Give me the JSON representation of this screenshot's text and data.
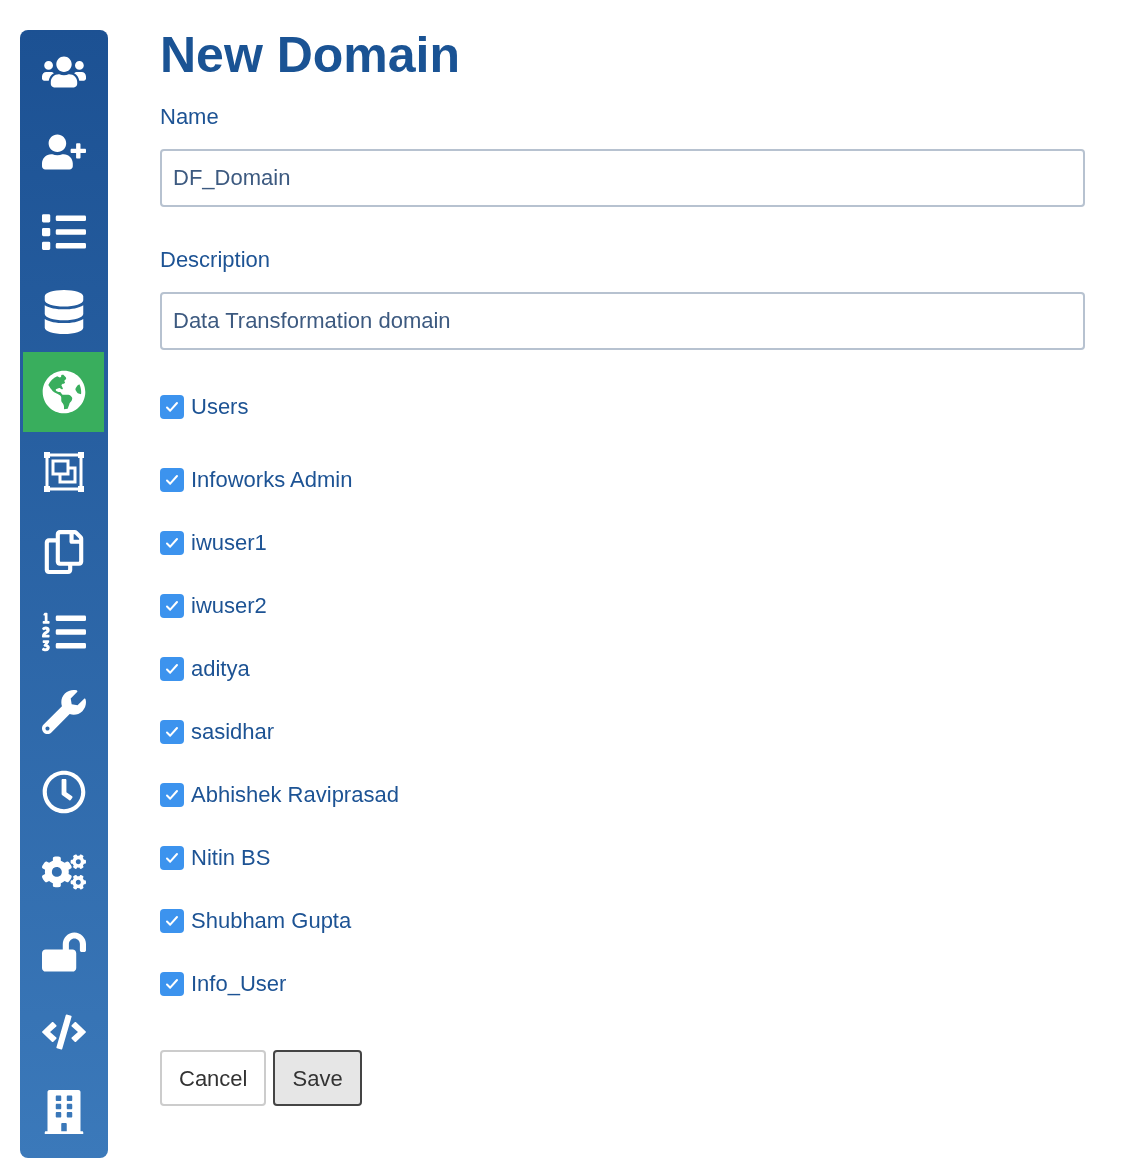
{
  "sidebar": {
    "items": [
      {
        "selected": false
      },
      {
        "selected": false
      },
      {
        "selected": false
      },
      {
        "selected": false
      },
      {
        "selected": true
      },
      {
        "selected": false
      },
      {
        "selected": false
      },
      {
        "selected": false
      },
      {
        "selected": false
      },
      {
        "selected": false
      },
      {
        "selected": false
      },
      {
        "selected": false
      },
      {
        "selected": false
      },
      {
        "selected": false
      }
    ]
  },
  "title": "New Domain",
  "fields": [
    {
      "label": "Name",
      "value": "DF_Domain"
    },
    {
      "label": "Description",
      "value": "Data Transformation domain"
    }
  ],
  "users_header": {
    "label": "Users",
    "checked": true
  },
  "users": [
    {
      "label": "Infoworks Admin",
      "checked": true
    },
    {
      "label": "iwuser1",
      "checked": true
    },
    {
      "label": "iwuser2",
      "checked": true
    },
    {
      "label": "aditya",
      "checked": true
    },
    {
      "label": "sasidhar",
      "checked": true
    },
    {
      "label": "Abhishek Raviprasad",
      "checked": true
    },
    {
      "label": "Nitin BS",
      "checked": true
    },
    {
      "label": "Shubham Gupta",
      "checked": true
    },
    {
      "label": "Info_User",
      "checked": true
    }
  ],
  "buttons": [
    {
      "label": "Cancel",
      "kind": "plain"
    },
    {
      "label": "Save",
      "kind": "primary"
    }
  ]
}
